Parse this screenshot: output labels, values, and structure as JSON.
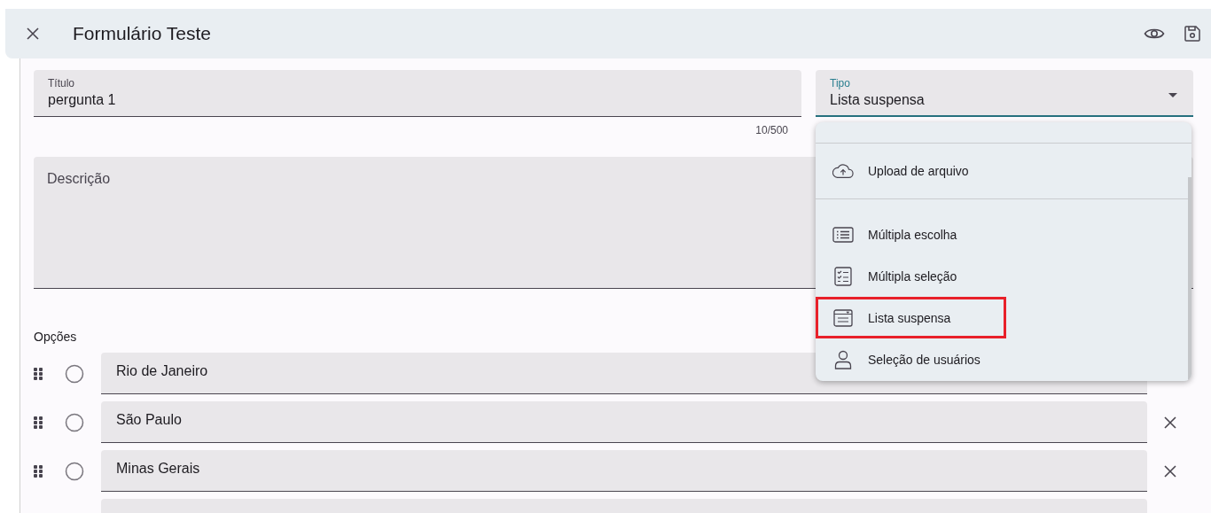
{
  "header": {
    "title": "Formulário Teste"
  },
  "title_field": {
    "label": "Título",
    "value": "pergunta 1",
    "counter": "10/500"
  },
  "type_field": {
    "label": "Tipo",
    "value": "Lista suspensa",
    "focused": true
  },
  "description_field": {
    "placeholder": "Descrição"
  },
  "options_label": "Opções",
  "options": [
    {
      "label": "Rio de Janeiro"
    },
    {
      "label": "São Paulo"
    },
    {
      "label": "Minas Gerais"
    }
  ],
  "type_menu": {
    "items": [
      {
        "label": "Upload de arquivo",
        "kind": "upload",
        "selected": false,
        "divider_after": true
      },
      {
        "label": "Múltipla escolha",
        "kind": "list",
        "selected": false,
        "divider_after": false
      },
      {
        "label": "Múltipla seleção",
        "kind": "checklist",
        "selected": false,
        "divider_after": false
      },
      {
        "label": "Lista suspensa",
        "kind": "dropdown",
        "selected": true,
        "divider_after": false
      },
      {
        "label": "Seleção de usuários",
        "kind": "user",
        "selected": false,
        "divider_after": false
      }
    ]
  }
}
